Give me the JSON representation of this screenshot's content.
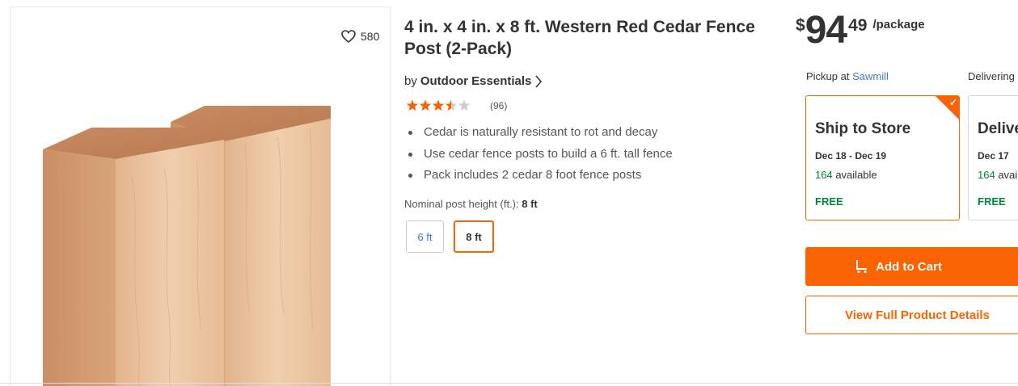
{
  "favorites": {
    "count": "580",
    "icon": "heart-outline-icon"
  },
  "product": {
    "title": "4 in. x 4 in. x 8 ft. Western Red Cedar Fence Post (2-Pack)",
    "by_prefix": "by",
    "brand": "Outdoor Essentials",
    "rating_value": 3.5,
    "rating_max": 5,
    "review_count": "(96)",
    "bullets": [
      "Cedar is naturally resistant to rot and decay",
      "Use cedar fence posts to build a 6 ft. tall fence",
      "Pack includes 2 cedar 8 foot fence posts"
    ],
    "option_label": "Nominal post height (ft.):",
    "option_selected": "8 ft",
    "options": [
      "6 ft",
      "8 ft"
    ]
  },
  "price": {
    "currency": "$",
    "dollars": "94",
    "cents": "49",
    "unit": "/package"
  },
  "fulfillment": {
    "pickup_prefix": "Pickup at",
    "pickup_store": "Sawmill",
    "delivery_label": "Delivering",
    "ship": {
      "title": "Ship to Store",
      "date": "Dec 18 - Dec 19",
      "available_num": "164",
      "available_text": "available",
      "price": "FREE"
    },
    "delivery": {
      "title": "Delivery",
      "date": "Dec 17",
      "available_num": "164",
      "available_text": "available",
      "price": "FREE"
    }
  },
  "actions": {
    "add_to_cart": "Add to Cart",
    "view_details": "View Full Product Details"
  },
  "colors": {
    "brand_orange": "#f96302",
    "link_blue": "#3d7dbf",
    "free_green": "#00873c",
    "star_orange": "#f96302"
  }
}
